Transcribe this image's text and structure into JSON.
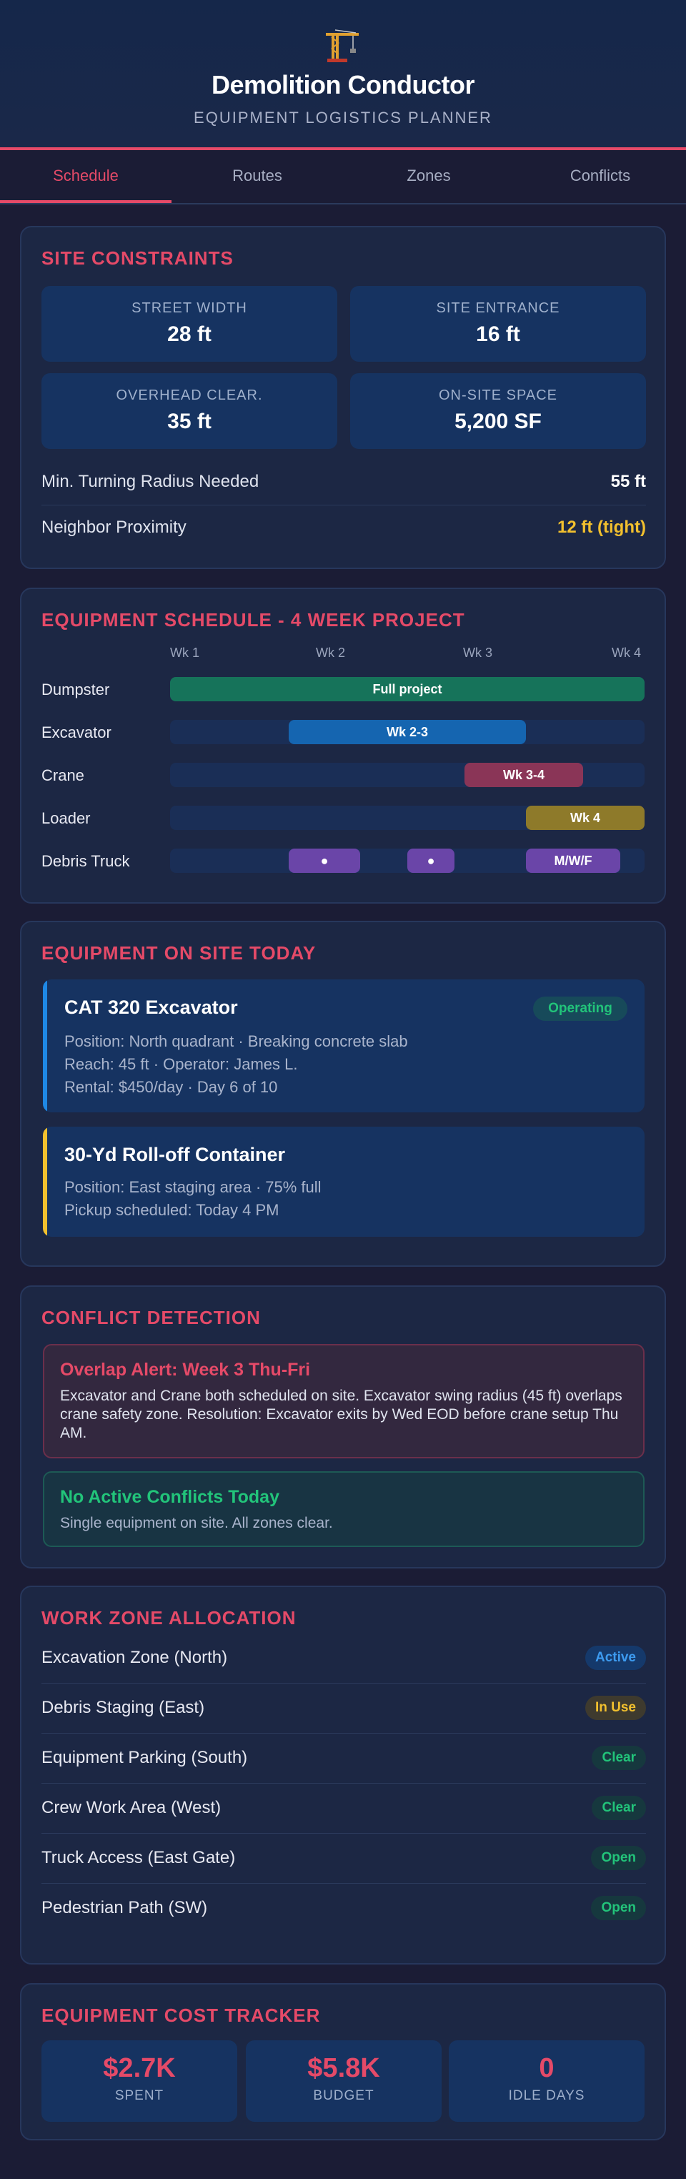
{
  "app": {
    "title": "Demolition Conductor",
    "subtitle": "EQUIPMENT LOGISTICS PLANNER",
    "logo_icon": "crane-icon"
  },
  "tabs": [
    {
      "label": "Schedule",
      "active": true
    },
    {
      "label": "Routes",
      "active": false
    },
    {
      "label": "Zones",
      "active": false
    },
    {
      "label": "Conflicts",
      "active": false
    }
  ],
  "site_constraints": {
    "title": "SITE CONSTRAINTS",
    "stats": [
      {
        "label": "STREET WIDTH",
        "value": "28 ft"
      },
      {
        "label": "SITE ENTRANCE",
        "value": "16 ft"
      },
      {
        "label": "OVERHEAD CLEAR.",
        "value": "35 ft"
      },
      {
        "label": "ON-SITE SPACE",
        "value": "5,200 SF"
      }
    ],
    "rows": [
      {
        "label": "Min. Turning Radius Needed",
        "value": "55 ft"
      },
      {
        "label": "Neighbor Proximity",
        "value": "12 ft (tight)",
        "color": "#f2c02e"
      }
    ]
  },
  "schedule": {
    "title": "EQUIPMENT SCHEDULE - 4 WEEK PROJECT",
    "weeks": [
      "Wk 1",
      "Wk 2",
      "Wk 3",
      "Wk 4"
    ],
    "rows": [
      {
        "label": "Dumpster",
        "bars": [
          {
            "text": "Full project",
            "color": "#16735a"
          }
        ]
      },
      {
        "label": "Excavator",
        "bars": [
          {
            "text": "Wk 2-3",
            "color": "#1565b0"
          }
        ]
      },
      {
        "label": "Crane",
        "bars": [
          {
            "text": "Wk 3-4",
            "color": "#8a3557"
          }
        ]
      },
      {
        "label": "Loader",
        "bars": [
          {
            "text": "Wk 4",
            "color": "#8e7a2a"
          }
        ]
      },
      {
        "label": "Debris Truck",
        "bars": [
          {
            "text": "●",
            "color": "#6a45a8"
          },
          {
            "text": "●",
            "color": "#6a45a8"
          },
          {
            "text": "M/W/F",
            "color": "#6a45a8"
          }
        ]
      }
    ]
  },
  "on_site": {
    "title": "EQUIPMENT ON SITE TODAY",
    "items": [
      {
        "name": "CAT 320 Excavator",
        "status": "Operating",
        "accent": "#1e88e5",
        "lines": [
          "Position: North quadrant · Breaking concrete slab",
          "Reach: 45 ft · Operator: James L.",
          "Rental: $450/day · Day 6 of 10"
        ]
      },
      {
        "name": "30-Yd Roll-off Container",
        "accent": "#f2c02e",
        "lines": [
          "Position: East staging area · 75% full",
          "Pickup scheduled: Today 4 PM"
        ]
      }
    ]
  },
  "conflicts": {
    "title": "CONFLICT DETECTION",
    "alert": {
      "title": "Overlap Alert: Week 3 Thu-Fri",
      "body": "Excavator and Crane both scheduled on site. Excavator swing radius (45 ft) overlaps crane safety zone. Resolution: Excavator exits by Wed EOD before crane setup Thu AM."
    },
    "ok": {
      "title": "No Active Conflicts Today",
      "body": "Single equipment on site. All zones clear."
    }
  },
  "zones": {
    "title": "WORK ZONE ALLOCATION",
    "items": [
      {
        "name": "Excavation Zone (North)",
        "status": "Active",
        "fg": "#3d9bf0",
        "bg": "#15396b"
      },
      {
        "name": "Debris Staging (East)",
        "status": "In Use",
        "fg": "#f2c02e",
        "bg": "#3e3a2e"
      },
      {
        "name": "Equipment Parking (South)",
        "status": "Clear",
        "fg": "#22c47a",
        "bg": "#16383e"
      },
      {
        "name": "Crew Work Area (West)",
        "status": "Clear",
        "fg": "#22c47a",
        "bg": "#16383e"
      },
      {
        "name": "Truck Access (East Gate)",
        "status": "Open",
        "fg": "#22c47a",
        "bg": "#16383e"
      },
      {
        "name": "Pedestrian Path (SW)",
        "status": "Open",
        "fg": "#22c47a",
        "bg": "#16383e"
      }
    ]
  },
  "cost": {
    "title": "EQUIPMENT COST TRACKER",
    "stats": [
      {
        "value": "$2.7K",
        "label": "SPENT"
      },
      {
        "value": "$5.8K",
        "label": "BUDGET"
      },
      {
        "value": "0",
        "label": "IDLE DAYS"
      }
    ]
  }
}
